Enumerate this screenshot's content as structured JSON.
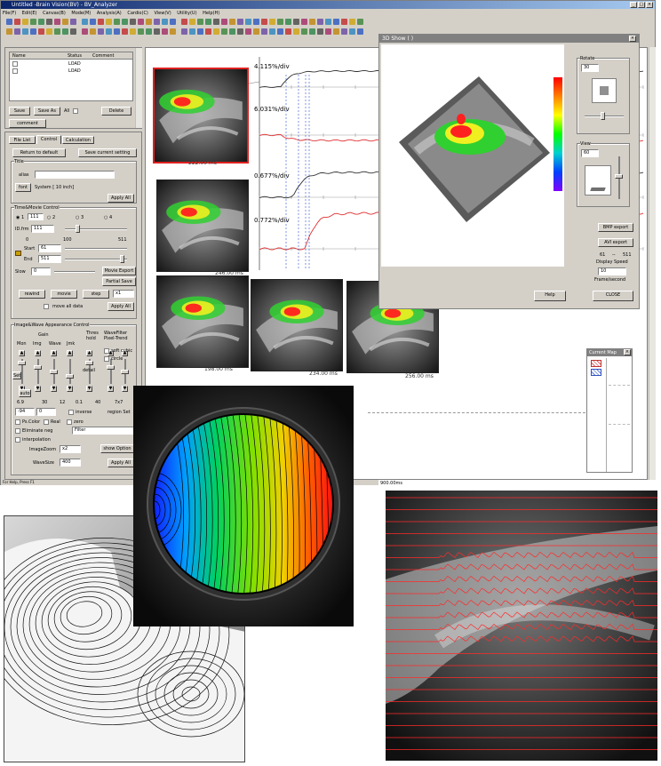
{
  "window": {
    "title": "Untitled -Brain Vision(BV) - BV_Analyzer",
    "menu": [
      "File(F)",
      "Edit(E)",
      "Canvas(B)",
      "Mode(M)",
      "Analysis(A)",
      "Cardio(C)",
      "View(V)",
      "Utility(U)",
      "Help(H)"
    ],
    "status": "For Help, Press F1"
  },
  "file_list": {
    "columns": [
      "Name",
      "Status",
      "Comment"
    ],
    "rows": [
      {
        "status": "LOAD"
      },
      {
        "status": "LOAD"
      }
    ],
    "buttons": [
      "Save",
      "Save As",
      "All",
      "Delete"
    ],
    "comment_label": "comment"
  },
  "tabs": [
    "File List",
    "Control",
    "Calculation"
  ],
  "control": {
    "return_default": "Return to default",
    "save_current": "Save current setting",
    "title_group": "Title",
    "alias_label": "alias",
    "font_button": "font",
    "font_value": "System [ 10 inch]",
    "apply_all": "Apply All",
    "time_group": "Time&Movie Control",
    "radios": [
      "1",
      "2",
      "3",
      "4"
    ],
    "id_label": "ID.frm",
    "id_value": "111",
    "range_min": "0",
    "range_mid": "100",
    "range_max": "511",
    "start_label": "Start",
    "start_value": "61",
    "end_label": "End",
    "end_value": "511",
    "slow_label": "Slow",
    "slow_value": "0",
    "movie_export": "Movie Export",
    "partial_save": "Partial Save",
    "rewind": "rewind",
    "movie": "movie",
    "step": "step",
    "speed": "x1",
    "move_all": "move all data",
    "apply_all2": "Apply All",
    "image_group": "Image&Wave Appearance Control",
    "gain_label": "Gain",
    "thres_label": "Thres hold",
    "wavefilter_label": "WaveFilter Pixel-Trend",
    "col_labels": [
      "Mon",
      "Img",
      "Wave",
      "Jmk"
    ],
    "soft_cubic": "soft cubic",
    "circle": "circle",
    "detail": "detail",
    "set_label": "Set",
    "auto_label": "auto",
    "vals": [
      "6.9",
      "30",
      "12",
      "0.1",
      "40",
      "7x7"
    ],
    "field1": "-94",
    "field2": "0",
    "inverse": "inverse",
    "region_set": "region Set",
    "pscolor": "Ps.Color",
    "real": "Real",
    "zero": "zero",
    "eliminate": "Eliminate neg",
    "filter": "Filter",
    "interpolation": "interpolation",
    "image_zoom_label": "ImageZoom",
    "image_zoom": "x2",
    "show_option": "show Option",
    "wave_size_label": "WaveSize",
    "wave_size": "400",
    "apply_all3": "Apply All"
  },
  "canvas": {
    "trace_labels": [
      "4.115%/div",
      "6.031%/div",
      "0.677%/div",
      "0.772%/div"
    ],
    "frame_times": [
      "222.00 ms",
      "246.00 ms",
      "198.00 ms",
      "234.00 ms",
      "256.00 ms"
    ]
  },
  "show3d": {
    "title": "3D Show ( )",
    "rotate_label": "Rotate",
    "rotate_value": "30",
    "view_label": "View",
    "view_value": "60",
    "bmp_export": "BMP export",
    "avi_export": "AVI export",
    "range_from": "61",
    "range_sep": "--",
    "range_to": "511",
    "display_speed": "Display Speed",
    "speed_value": "10",
    "frames_label": "Frame/second",
    "help": "Help",
    "close": "CLOSE"
  },
  "current_map": {
    "title": "Current Map"
  },
  "wave_panel": {
    "time_label": "900.00ms"
  },
  "colors": {
    "title_blue": "#0a246a",
    "face": "#d4d0c8",
    "trace_black": "#333333",
    "trace_red": "#e03030",
    "marker_blue": "#3050d0"
  }
}
